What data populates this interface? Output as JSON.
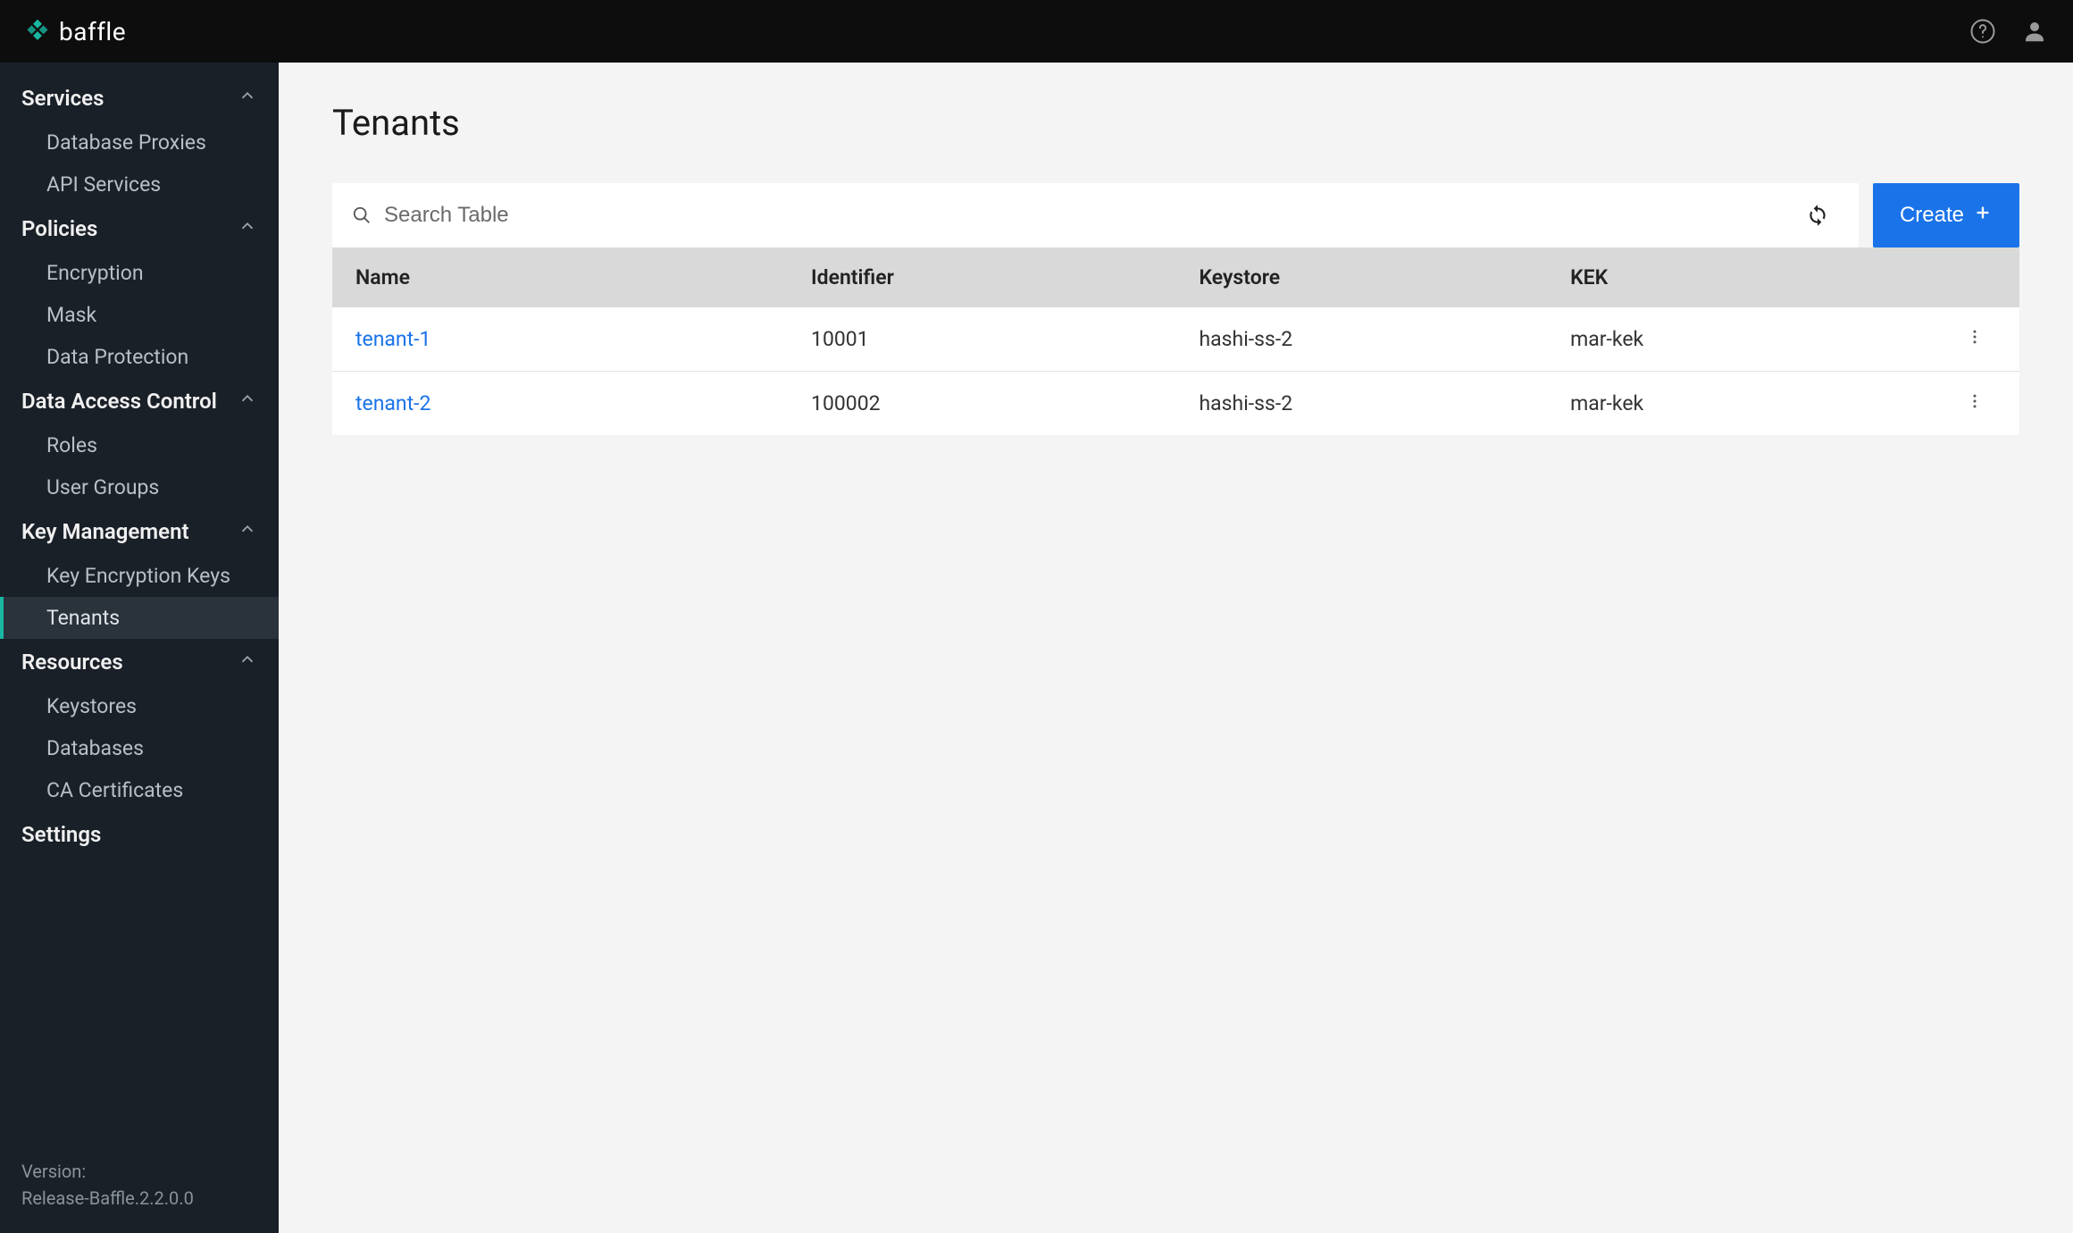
{
  "brand": {
    "name": "baffle"
  },
  "topbar": {
    "help_icon": "help",
    "user_icon": "person"
  },
  "sidebar": {
    "sections": [
      {
        "label": "Services",
        "expanded": true,
        "items": [
          {
            "label": "Database Proxies"
          },
          {
            "label": "API Services"
          }
        ]
      },
      {
        "label": "Policies",
        "expanded": true,
        "items": [
          {
            "label": "Encryption"
          },
          {
            "label": "Mask"
          },
          {
            "label": "Data Protection"
          }
        ]
      },
      {
        "label": "Data Access Control",
        "expanded": true,
        "items": [
          {
            "label": "Roles"
          },
          {
            "label": "User Groups"
          }
        ]
      },
      {
        "label": "Key Management",
        "expanded": true,
        "items": [
          {
            "label": "Key Encryption Keys"
          },
          {
            "label": "Tenants",
            "active": true
          }
        ]
      },
      {
        "label": "Resources",
        "expanded": true,
        "items": [
          {
            "label": "Keystores"
          },
          {
            "label": "Databases"
          },
          {
            "label": "CA Certificates"
          }
        ]
      }
    ],
    "settings_label": "Settings",
    "footer": {
      "version_label": "Version:",
      "version_value": "Release-Baffle.2.2.0.0"
    }
  },
  "page": {
    "title": "Tenants",
    "search_placeholder": "Search Table",
    "create_label": "Create"
  },
  "table": {
    "columns": [
      "Name",
      "Identifier",
      "Keystore",
      "KEK"
    ],
    "rows": [
      {
        "name": "tenant-1",
        "identifier": "10001",
        "keystore": "hashi-ss-2",
        "kek": "mar-kek"
      },
      {
        "name": "tenant-2",
        "identifier": "100002",
        "keystore": "hashi-ss-2",
        "kek": "mar-kek"
      }
    ]
  }
}
